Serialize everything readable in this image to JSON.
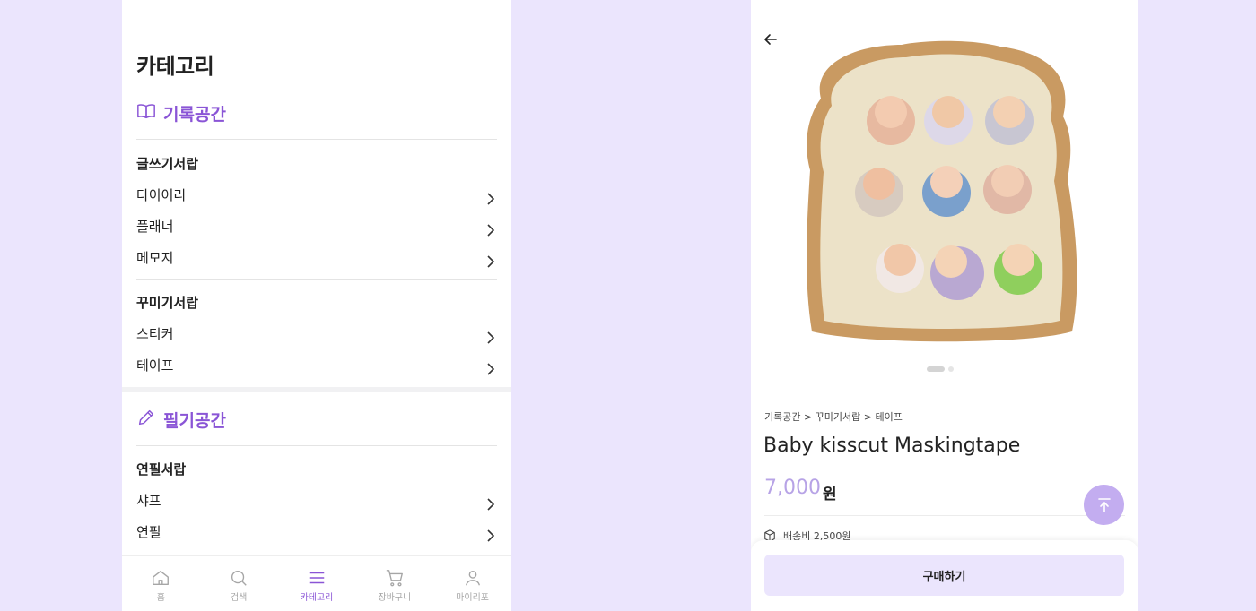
{
  "category_screen": {
    "title": "카테고리",
    "sections": [
      {
        "name": "기록공간",
        "icon": "book-icon",
        "groups": [
          {
            "title": "글쓰기서랍",
            "items": [
              "다이어리",
              "플래너",
              "메모지"
            ]
          },
          {
            "title": "꾸미기서랍",
            "items": [
              "스티커",
              "테이프"
            ]
          }
        ]
      },
      {
        "name": "필기공간",
        "icon": "pencil-icon",
        "groups": [
          {
            "title": "연필서랍",
            "items": [
              "샤프",
              "연필"
            ]
          }
        ]
      }
    ],
    "bottom_nav": [
      {
        "label": "홈",
        "icon": "home-icon"
      },
      {
        "label": "검색",
        "icon": "search-icon"
      },
      {
        "label": "카테고리",
        "icon": "menu-icon",
        "active": true
      },
      {
        "label": "장바구니",
        "icon": "cart-icon"
      },
      {
        "label": "마이리포",
        "icon": "user-icon"
      }
    ]
  },
  "product_screen": {
    "breadcrumb": "기록공간 > 꾸미기서랍 > 테이프",
    "product_name": "Baby kisscut Maskingtape",
    "price": "7,000",
    "currency": "원",
    "shipping": "배송비 2,500원",
    "buy_button": "구매하기",
    "image_slide": {
      "current": 1,
      "total": 2
    }
  },
  "colors": {
    "background": "#ebe5fd",
    "accent": "#8a55d6",
    "price": "#b7a3e6",
    "top_button": "#c3adf0"
  }
}
